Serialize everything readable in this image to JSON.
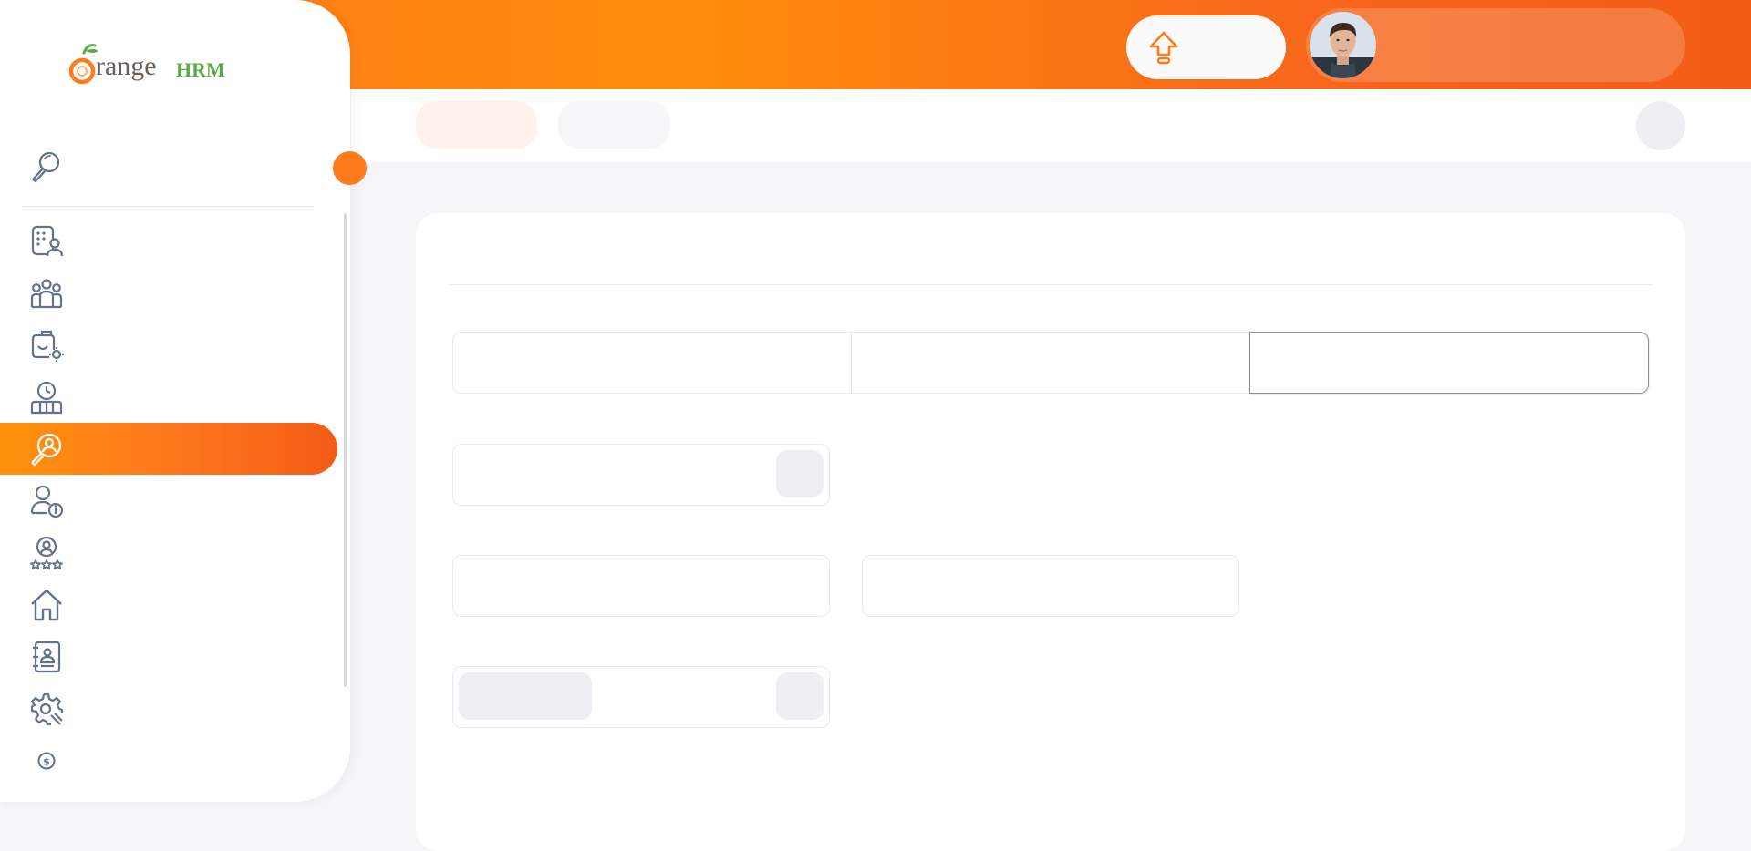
{
  "brand": {
    "name": "OrangeHRM",
    "logo_text_orange": "range",
    "logo_text_green": "HRM",
    "accent_color": "#ff7b1d",
    "green_color": "#5ba943"
  },
  "topbar": {
    "upgrade_icon": "upgrade-arrow-icon",
    "upgrade_label": "",
    "user_avatar": "user-avatar",
    "user_name": ""
  },
  "secondbar": {
    "tab1_label": "",
    "tab2_label": "",
    "help_icon": "help-icon"
  },
  "sidebar": {
    "search_icon": "search-icon",
    "search_label": "",
    "items": [
      {
        "icon": "admin-icon",
        "label": "",
        "active": false
      },
      {
        "icon": "pim-icon",
        "label": "",
        "active": false
      },
      {
        "icon": "leave-icon",
        "label": "",
        "active": false
      },
      {
        "icon": "time-icon",
        "label": "",
        "active": false
      },
      {
        "icon": "recruitment-icon",
        "label": "",
        "active": true
      },
      {
        "icon": "my-info-icon",
        "label": "",
        "active": false
      },
      {
        "icon": "performance-icon",
        "label": "",
        "active": false
      },
      {
        "icon": "dashboard-icon",
        "label": "",
        "active": false
      },
      {
        "icon": "directory-icon",
        "label": "",
        "active": false
      },
      {
        "icon": "maintenance-icon",
        "label": "",
        "active": false
      },
      {
        "icon": "buzz-icon",
        "label": "",
        "active": false
      }
    ]
  },
  "form": {
    "title": "",
    "first_name_placeholder": "",
    "middle_name_placeholder": "",
    "last_name_placeholder": "",
    "employee_id_value": "",
    "other_id_value": "",
    "drivers_license_value": "",
    "browse_label": ""
  }
}
